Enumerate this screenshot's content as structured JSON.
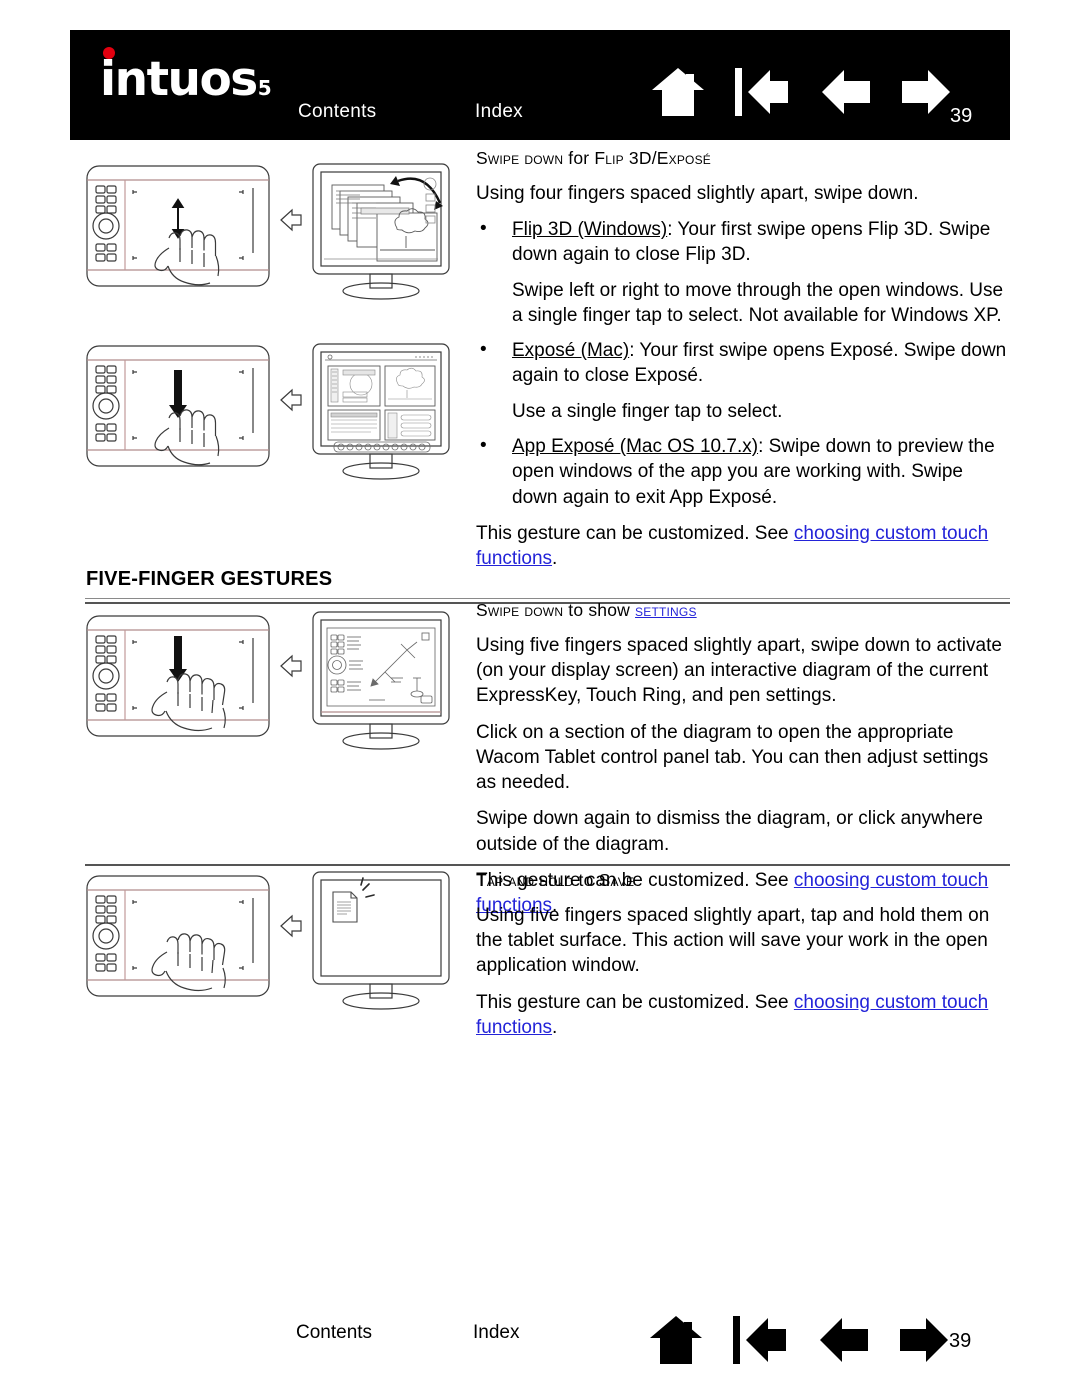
{
  "header": {
    "logo_word": "intuos",
    "logo_subscript": "5",
    "contents_label": "Contents",
    "index_label": "Index",
    "page_number": "39",
    "icons": [
      "home-icon",
      "first-page-icon",
      "previous-page-icon",
      "next-page-icon"
    ],
    "background_color": "#000000",
    "logo_dot_color": "#e3000f"
  },
  "sections": [
    {
      "subhead_parts": [
        {
          "text": "Swipe down",
          "style": "small-caps"
        },
        {
          "text": " for ",
          "style": "normal"
        },
        {
          "text": "Flip 3D/Exposé",
          "style": "small-caps"
        }
      ],
      "subhead_plain": "SWIPE DOWN for FLIP 3D/EXPOSÉ",
      "intro": "Using four fingers spaced slightly apart, swipe down.",
      "bullets": [
        {
          "lead": "Flip 3D (Windows)",
          "body": ": Your first swipe opens Flip 3D. Swipe down again to close Flip 3D.",
          "extra": "Swipe left or right to move through the open windows. Use a single finger tap to select.  Not available for Windows XP."
        },
        {
          "lead": "Exposé (Mac)",
          "body": ": Your first swipe opens Exposé. Swipe down again to close Exposé.",
          "extra": "Use a single finger tap to select."
        },
        {
          "lead": "App Exposé (Mac OS 10.7.x)",
          "body": ":  Swipe down to preview the open windows of the app you are working with. Swipe down again to exit App Exposé.",
          "extra": ""
        }
      ],
      "customize_prefix": "This gesture can be customized.  See ",
      "customize_link": "choosing custom touch functions",
      "customize_suffix": "."
    },
    {
      "subhead_plain": "SWIPE DOWN to show SETTINGS",
      "subhead_link": "settings",
      "paras": [
        "Using five fingers spaced slightly apart, swipe down to activate (on your display screen) an interactive diagram of the current ExpressKey, Touch Ring, and pen settings.",
        "Click on a section of the diagram to open the appropriate Wacom Tablet control panel tab.  You can then adjust settings as needed.",
        "Swipe down again to dismiss the diagram, or click anywhere outside of the diagram."
      ],
      "customize_prefix": "This gesture can be customized.  See ",
      "customize_link": "choosing custom touch functions",
      "customize_suffix": "."
    },
    {
      "subhead_plain": "TAP AND HOLD to SAVE",
      "paras": [
        "Using five fingers spaced slightly apart, tap and hold them on the tablet surface.  This action will save your work in the open application window."
      ],
      "customize_prefix": "This gesture can be customized.  See ",
      "customize_link": "choosing custom touch functions",
      "customize_suffix": "."
    }
  ],
  "heading_five_finger": "FIVE-FINGER GESTURES",
  "subhead_swipe_down_flip": {
    "a": "Swipe down",
    "b": " for ",
    "c": "Flip 3D/Exposé"
  },
  "subhead_swipe_settings": {
    "a": "Swipe down",
    "b": " to show ",
    "c": "settings"
  },
  "subhead_tap_hold": {
    "a": "Tap and hold",
    "b": " to ",
    "c": "Save"
  },
  "figures": [
    {
      "name": "four-finger-swipe-down-flip3d-illustration",
      "caption": "Tablet with four-finger downward swipe, monitor showing Flip 3D stacked windows"
    },
    {
      "name": "four-finger-swipe-down-expose-illustration",
      "caption": "Tablet with four-finger downward swipe, monitor showing Exposé window grid"
    },
    {
      "name": "five-finger-swipe-down-settings-illustration",
      "caption": "Tablet with five-finger downward swipe, monitor showing interactive settings diagram"
    },
    {
      "name": "five-finger-tap-hold-save-illustration",
      "caption": "Tablet with five-finger tap and hold, monitor showing document save icon"
    }
  ],
  "footer": {
    "contents_label": "Contents",
    "index_label": "Index",
    "page_number": "39",
    "icons": [
      "home-icon",
      "first-page-icon",
      "previous-page-icon",
      "next-page-icon"
    ]
  },
  "colors": {
    "link": "#2323d8",
    "logo_red": "#e3000f",
    "rule": "#6f6f6f"
  }
}
